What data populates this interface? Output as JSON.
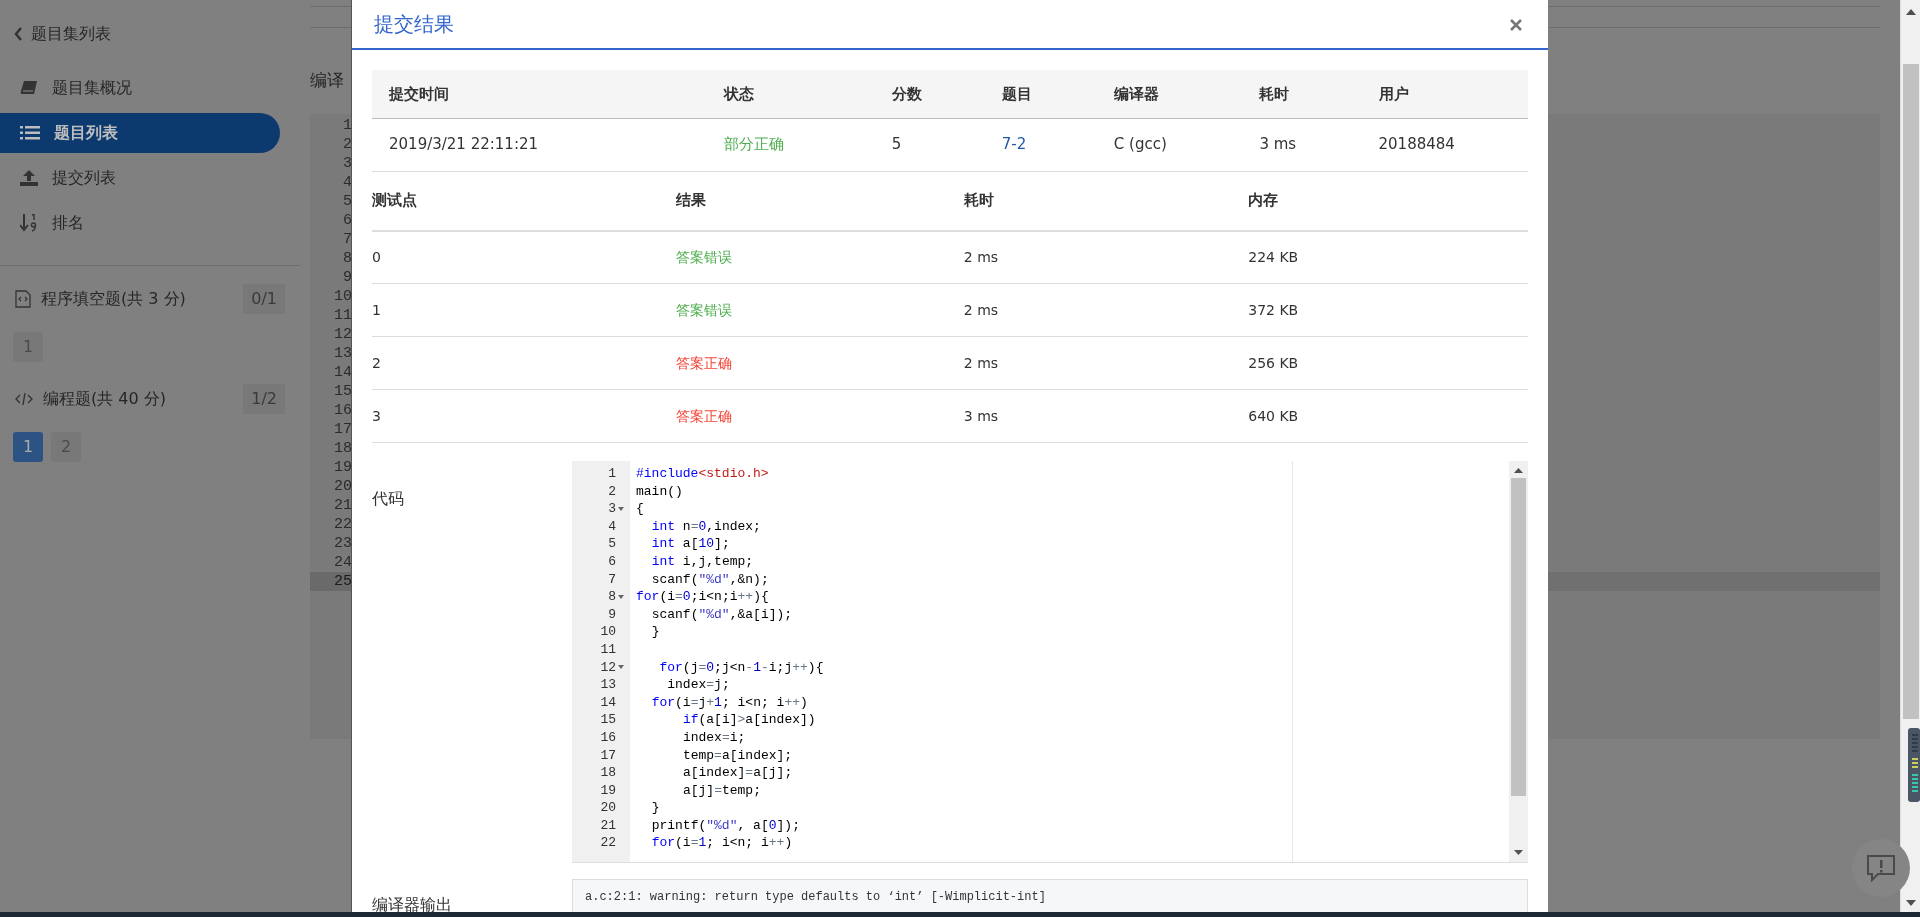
{
  "sidebar": {
    "back_link": "题目集列表",
    "nav": [
      {
        "label": "题目集概况",
        "selected": false
      },
      {
        "label": "题目列表",
        "selected": true
      },
      {
        "label": "提交列表",
        "selected": false
      },
      {
        "label": "排名",
        "selected": false
      }
    ],
    "sections": [
      {
        "title": "程序填空题(共 3 分)",
        "badge": "0/1",
        "problems": [
          {
            "label": "1",
            "selected": false
          }
        ]
      },
      {
        "title": "编程题(共 40 分)",
        "badge": "1/2",
        "problems": [
          {
            "label": "1",
            "selected": true
          },
          {
            "label": "2",
            "selected": false
          }
        ]
      }
    ]
  },
  "background": {
    "heading": "编译",
    "line_numbers": [
      {
        "n": "1",
        "active": false
      },
      {
        "n": "2",
        "active": false
      },
      {
        "n": "3",
        "active": false
      },
      {
        "n": "4",
        "active": false
      },
      {
        "n": "5",
        "active": false
      },
      {
        "n": "6",
        "active": false
      },
      {
        "n": "7",
        "active": false
      },
      {
        "n": "8",
        "active": false
      },
      {
        "n": "9",
        "active": false
      },
      {
        "n": "10",
        "active": false
      },
      {
        "n": "11",
        "active": false
      },
      {
        "n": "12",
        "active": false
      },
      {
        "n": "13",
        "active": false
      },
      {
        "n": "14",
        "active": false
      },
      {
        "n": "15",
        "active": false
      },
      {
        "n": "16",
        "active": false
      },
      {
        "n": "17",
        "active": false
      },
      {
        "n": "18",
        "active": false
      },
      {
        "n": "19",
        "active": false
      },
      {
        "n": "20",
        "active": false
      },
      {
        "n": "21",
        "active": false
      },
      {
        "n": "22",
        "active": false
      },
      {
        "n": "23",
        "active": false
      },
      {
        "n": "24",
        "active": false
      },
      {
        "n": "25",
        "active": true
      }
    ]
  },
  "modal": {
    "title": "提交结果",
    "submission": {
      "columns": [
        "提交时间",
        "状态",
        "分数",
        "题目",
        "编译器",
        "耗时",
        "用户"
      ],
      "row": [
        {
          "kind": "text",
          "text": "2019/3/21 22:11:21"
        },
        {
          "kind": "status",
          "text": "部分正确",
          "color": "#4cae4c"
        },
        {
          "kind": "text",
          "text": "5"
        },
        {
          "kind": "link",
          "text": "7-2"
        },
        {
          "kind": "text",
          "text": "C (gcc)"
        },
        {
          "kind": "text",
          "text": "3 ms"
        },
        {
          "kind": "text",
          "text": "20188484"
        }
      ]
    },
    "tests": {
      "columns": [
        "测试点",
        "结果",
        "耗时",
        "内存"
      ],
      "rows": [
        {
          "case": "0",
          "result": "答案错误",
          "color": "#4cae4c",
          "time": "2 ms",
          "memory": "224 KB"
        },
        {
          "case": "1",
          "result": "答案错误",
          "color": "#4cae4c",
          "time": "2 ms",
          "memory": "372 KB"
        },
        {
          "case": "2",
          "result": "答案正确",
          "color": "#f44336",
          "time": "2 ms",
          "memory": "256 KB"
        },
        {
          "case": "3",
          "result": "答案正确",
          "color": "#f44336",
          "time": "3 ms",
          "memory": "640 KB"
        }
      ]
    },
    "code": {
      "label": "代码",
      "lines": [
        {
          "n": "1",
          "fold": false,
          "text": "#include<stdio.h>"
        },
        {
          "n": "2",
          "fold": false,
          "text": "main()"
        },
        {
          "n": "3",
          "fold": true,
          "text": "{"
        },
        {
          "n": "4",
          "fold": false,
          "text": "  int n=0,index;"
        },
        {
          "n": "5",
          "fold": false,
          "text": "  int a[10];"
        },
        {
          "n": "6",
          "fold": false,
          "text": "  int i,j,temp;"
        },
        {
          "n": "7",
          "fold": false,
          "text": "  scanf(\"%d\",&n);"
        },
        {
          "n": "8",
          "fold": true,
          "text": "for(i=0;i<n;i++){"
        },
        {
          "n": "9",
          "fold": false,
          "text": "  scanf(\"%d\",&a[i]);"
        },
        {
          "n": "10",
          "fold": false,
          "text": "  }"
        },
        {
          "n": "11",
          "fold": false
        },
        {
          "n": "12",
          "fold": true,
          "text": "   for(j=0;j<n-1-i;j++){"
        },
        {
          "n": "13",
          "fold": false,
          "text": "    index=j;"
        },
        {
          "n": "14",
          "fold": false,
          "text": "  for(i=j+1; i<n; i++)"
        },
        {
          "n": "15",
          "fold": false,
          "text": "      if(a[i]>a[index])"
        },
        {
          "n": "16",
          "fold": false,
          "text": "      index=i;"
        },
        {
          "n": "17",
          "fold": false,
          "text": "      temp=a[index];"
        },
        {
          "n": "18",
          "fold": false,
          "text": "      a[index]=a[j];"
        },
        {
          "n": "19",
          "fold": false,
          "text": "      a[j]=temp;"
        },
        {
          "n": "20",
          "fold": false,
          "text": "  }"
        },
        {
          "n": "21",
          "fold": false,
          "text": "  printf(\"%d\", a[0]);"
        },
        {
          "n": "22",
          "fold": false,
          "text": "  for(i=1; i<n; i++)"
        }
      ]
    },
    "compiler_output": {
      "label": "编译器输出",
      "text": "a.c:2:1: warning: return type defaults to ‘int’ [-Wimplicit-int]"
    }
  }
}
